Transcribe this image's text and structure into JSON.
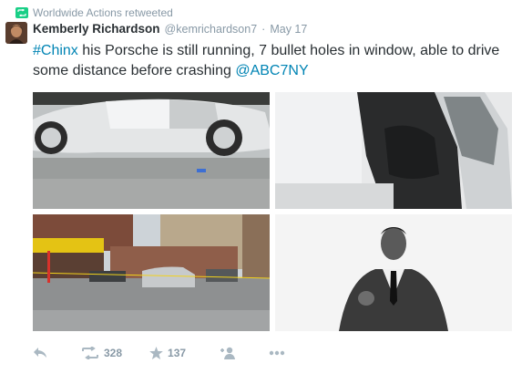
{
  "retweet_context": {
    "label": "Worldwide Actions retweeted",
    "icon": "retweet-icon"
  },
  "tweet": {
    "author_name": "Kemberly Richardson",
    "author_handle": "@kemrichardson7",
    "separator": "·",
    "date": "May 17",
    "text": {
      "hashtag": "#Chinx",
      "body": " his Porsche is still running, 7 bullet holes in window, able to drive some distance before crashing ",
      "mention": "@ABC7NY"
    },
    "photos": [
      {
        "name": "photo-porsche-side",
        "subject": "Silver Porsche parked, side view with open door"
      },
      {
        "name": "photo-porsche-door-interior",
        "subject": "Open driver door of silver Porsche"
      },
      {
        "name": "photo-street-scene",
        "subject": "Street corner with police tape and cars"
      },
      {
        "name": "photo-portrait",
        "subject": "Black and white portrait of man in suit"
      }
    ],
    "actions": {
      "reply": {
        "icon": "reply-icon"
      },
      "retweet": {
        "icon": "retweet-icon",
        "count": "328"
      },
      "favorite": {
        "icon": "star-icon",
        "count": "137"
      },
      "follow": {
        "icon": "add-user-icon"
      },
      "more": {
        "icon": "more-icon"
      }
    }
  },
  "colors": {
    "link": "#0084b4",
    "retweet_green": "#19cf86",
    "muted": "#8899a6",
    "action_icon": "#aab8c2"
  }
}
